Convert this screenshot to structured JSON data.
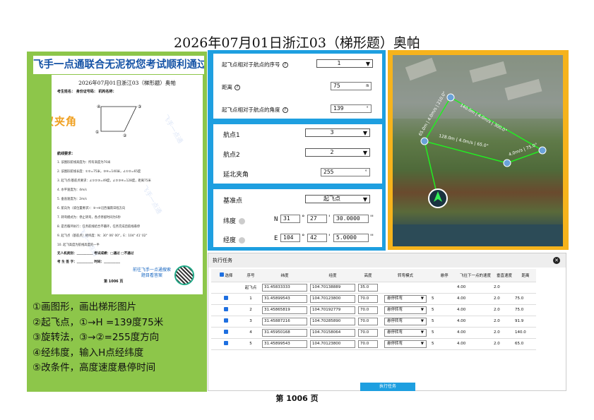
{
  "title": "2026年07月01日浙江03（梯形题）奥帕",
  "banner": "飞手一点通联合无泥祝您考试顺利通过",
  "exam_doc": {
    "title": "2026年07月01日浙江03（梯形题）奥帕",
    "fields_line": "考生姓名：        身份证号码：             机构名称：",
    "tag": "双夹角",
    "diagram_points": [
      "④",
      "③",
      "①",
      "②"
    ],
    "requirements_heading": "航线要求：",
    "requirements": [
      "1. 该图形航线高度为：所有高度为70米",
      "2. 该图形航线长度：①②=75米，③④=140米，∠①②=65度",
      "3. 起飞点/基航点要求：∠①②③=49度，∠②③④=128度，距离75米",
      "4. 水平速度为：4m/s",
      "5. 垂直速度为：2m/s",
      "6. 航向为（或位置要求）：⑤→⑥沿西偏南日程方向",
      "7. 转弯模式为：停止转弯，各点停留时间为5秒",
      "8. 是否循环执行：任务航线结合不循环，任务完成后航线悬停",
      "9. 起飞点（基航点）经纬度：N：30° 06' 00\"，E：104° 41' 02\"",
      "10. 起飞高度为航线高度的一半"
    ],
    "footer_line1": "无人机类别：__________     考试成绩：□通过  □不通过",
    "footer_line2": "考 生 签 字：__________     时间：__________",
    "page": "第 1006 页",
    "cta": "前往飞手一点通搜索题目看答案",
    "watermark": "飞手一点通"
  },
  "steps": [
    "①画图形，画出梯形图片",
    "②起飞点，①→H =139度75米",
    "③旋转法，③→②=255度方向",
    "④经纬度，输入H点经纬度",
    "⑤改条件，高度速度悬停时间"
  ],
  "settings": {
    "ref_index_label": "起飞点相对于航点的序号",
    "ref_index_value": "1",
    "distance_label": "距离",
    "distance_value": "75",
    "distance_unit": "m",
    "angle_label": "起飞点相对于航点的角度",
    "angle_value": "139",
    "angle_unit": "°",
    "wp1_label": "航点1",
    "wp1_value": "3",
    "wp2_label": "航点2",
    "wp2_value": "2",
    "north_angle_label": "延北夹角",
    "north_angle_value": "255",
    "north_angle_unit": "°",
    "base_label": "基准点",
    "base_value": "起飞点",
    "lat_label": "纬度",
    "lat_hemi": "N",
    "lat_deg": "31",
    "lat_min": "27",
    "lat_sec": "30.0000",
    "lon_label": "经度",
    "lon_hemi": "E",
    "lon_deg": "104",
    "lon_min": "42",
    "lon_sec": "5.0000",
    "deg_sym": "°",
    "min_sym": "'",
    "sec_sym": "''"
  },
  "map": {
    "labels": [
      "140.0m | 4.0m/s | 300.0°",
      "128.0m | 4.0m/s | 65.0°",
      "75.0m | 4.0m/s | 110.0°",
      "91.9m | 4.0m/s | 300.0°",
      "65.0m | 4.0m/s | 210.0°",
      "4.0m/s | 75.0°"
    ],
    "waypoints": [
      "1",
      "2",
      "3",
      "4",
      "5"
    ]
  },
  "task": {
    "title": "执行任务",
    "columns": [
      "选择",
      "序号",
      "纬度",
      "经度",
      "高度",
      "转弯模式",
      "悬停",
      "飞往下一点的速度",
      "垂直速度",
      "距离"
    ],
    "rows": [
      {
        "sel": "",
        "idx": "起飞点",
        "lat": "31.45833333",
        "lon": "104.70138889",
        "alt": "35.0",
        "mode": "",
        "hover": "",
        "speed": "4.00",
        "vspeed": "2.0",
        "dist": ""
      },
      {
        "sel": "■",
        "idx": "1",
        "lat": "31.45899543",
        "lon": "104.70123800",
        "alt": "70.0",
        "mode": "悬停转弯",
        "hover": "5",
        "speed": "4.00",
        "vspeed": "2.0",
        "dist": "75.0"
      },
      {
        "sel": "■",
        "idx": "2",
        "lat": "31.45865819",
        "lon": "104.70192779",
        "alt": "70.0",
        "mode": "悬停转弯",
        "hover": "5",
        "speed": "4.00",
        "vspeed": "2.0",
        "dist": "75.0"
      },
      {
        "sel": "■",
        "idx": "3",
        "lat": "31.45887216",
        "lon": "104.70285890",
        "alt": "70.0",
        "mode": "悬停转弯",
        "hover": "5",
        "speed": "4.00",
        "vspeed": "2.0",
        "dist": "91.9"
      },
      {
        "sel": "■",
        "idx": "4",
        "lat": "31.45950168",
        "lon": "104.70158064",
        "alt": "70.0",
        "mode": "悬停转弯",
        "hover": "5",
        "speed": "4.00",
        "vspeed": "2.0",
        "dist": "140.0"
      },
      {
        "sel": "■",
        "idx": "5",
        "lat": "31.45899543",
        "lon": "104.70123800",
        "alt": "70.0",
        "mode": "悬停转弯",
        "hover": "5",
        "speed": "4.00",
        "vspeed": "2.0",
        "dist": "65.0"
      }
    ],
    "exec_button": "执行任务"
  },
  "page_number": "第 1006 页"
}
